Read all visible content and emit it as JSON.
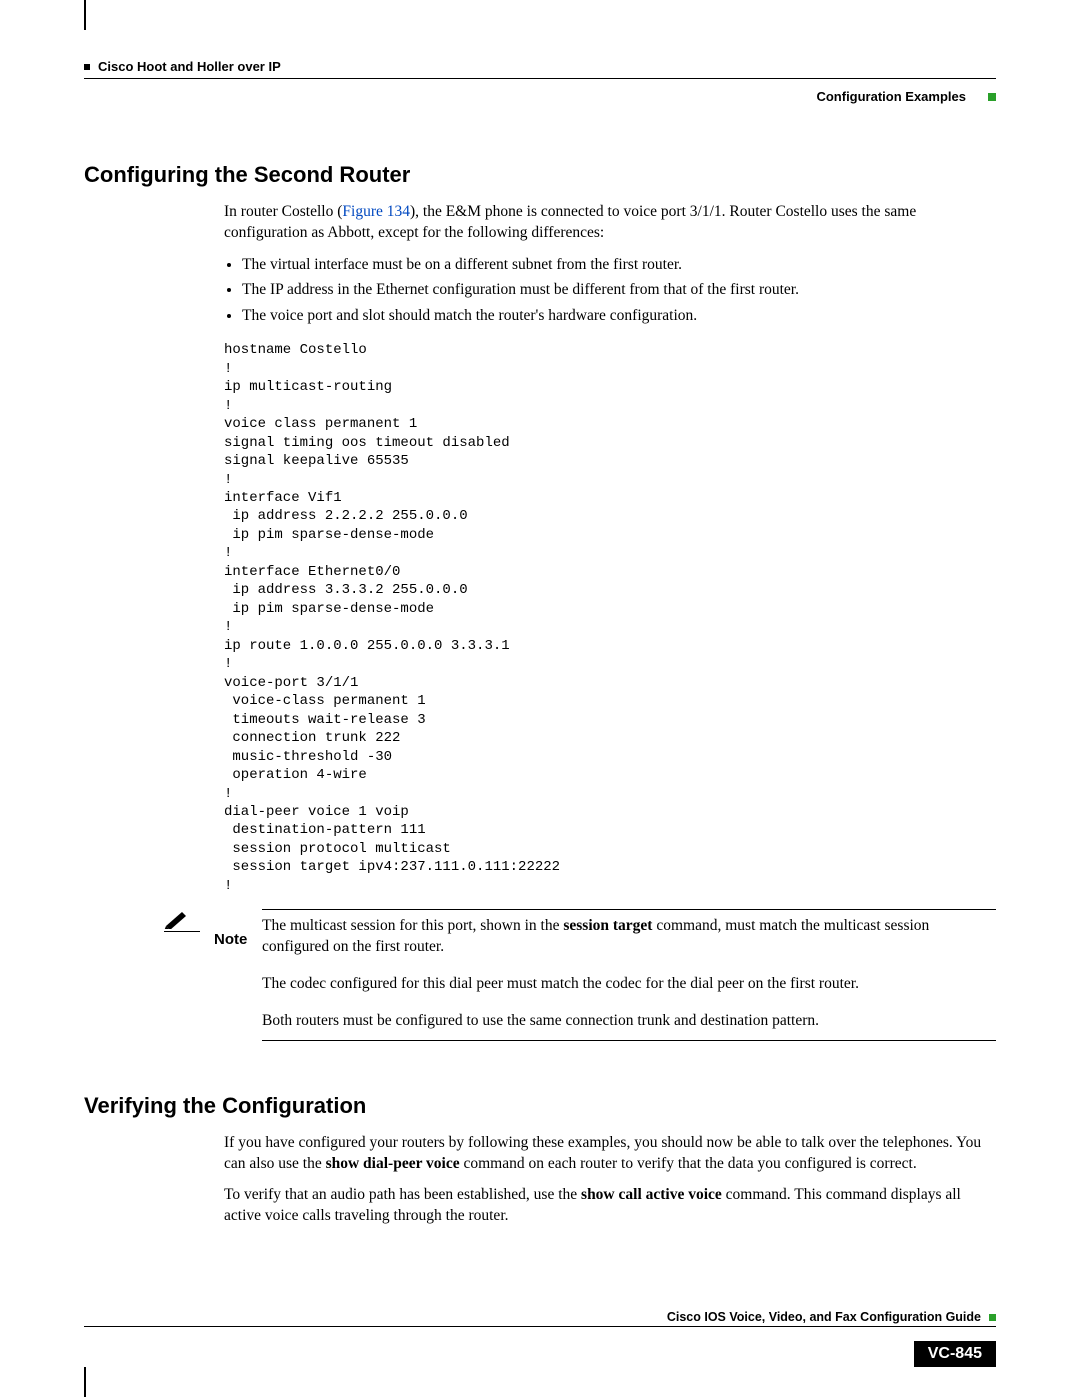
{
  "header": {
    "chapter": "Cisco Hoot and Holler over IP",
    "section": "Configuration Examples"
  },
  "h1": "Configuring the Second Router",
  "intro": {
    "before": "In router Costello (",
    "link": "Figure 134",
    "after": "), the E&M phone is connected to voice port 3/1/1. Router Costello uses the same configuration as Abbott, except for the following differences:"
  },
  "bullets": [
    "The virtual interface must be on a different subnet from the first router.",
    "The IP address in the Ethernet configuration must be different from that of the first router.",
    "The voice port and slot should match the router's hardware configuration."
  ],
  "code": "hostname Costello\n!\nip multicast-routing\n!\nvoice class permanent 1\nsignal timing oos timeout disabled\nsignal keepalive 65535\n!\ninterface Vif1\n ip address 2.2.2.2 255.0.0.0\n ip pim sparse-dense-mode\n!\ninterface Ethernet0/0\n ip address 3.3.3.2 255.0.0.0\n ip pim sparse-dense-mode\n!\nip route 1.0.0.0 255.0.0.0 3.3.3.1\n!\nvoice-port 3/1/1\n voice-class permanent 1\n timeouts wait-release 3\n connection trunk 222\n music-threshold -30\n operation 4-wire\n!\ndial-peer voice 1 voip\n destination-pattern 111\n session protocol multicast\n session target ipv4:237.111.0.111:22222\n!",
  "note": {
    "label": "Note",
    "text_before": "The multicast session for this port, shown in the ",
    "bold1": "session target",
    "text_after1": " command, must match the multicast session configured on the first router.",
    "para2": "The codec configured for this dial peer must match the codec for the dial peer on the first router.",
    "para3": "Both routers must be configured to use the same connection trunk and destination pattern."
  },
  "h2": "Verifying the Configuration",
  "verify": {
    "p1_a": "If you have configured your routers by following these examples, you should now be able to talk over the telephones. You can also use the ",
    "p1_b": "show dial-peer voice",
    "p1_c": " command on each router to verify that the data you configured is correct.",
    "p2_a": "To verify that an audio path has been established, use the ",
    "p2_b": "show call active voice",
    "p2_c": " command. This command displays all active voice calls traveling through the router."
  },
  "footer": {
    "guide": "Cisco IOS Voice, Video, and Fax Configuration Guide",
    "page": "VC-845"
  }
}
